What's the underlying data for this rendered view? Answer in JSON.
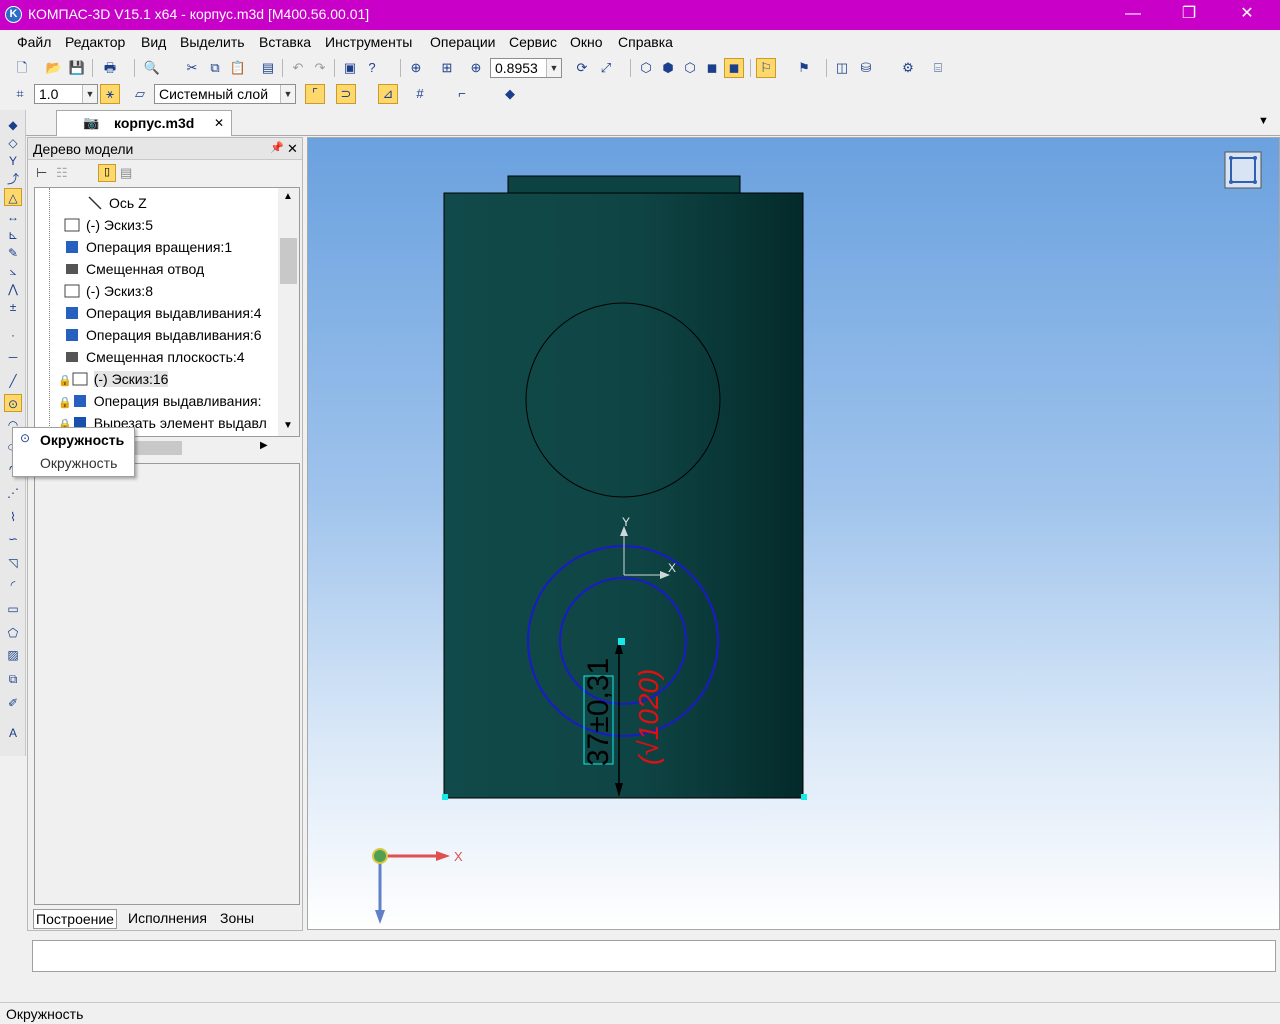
{
  "window": {
    "title": "КОМПАС-3D V15.1 x64 - корпус.m3d [M400.56.00.01]",
    "logo_text": "K",
    "minimize_glyph": "—",
    "maximize_glyph": "❐",
    "close_glyph": "✕"
  },
  "menu": [
    "Файл",
    "Редактор",
    "Вид",
    "Выделить",
    "Вставка",
    "Инструменты",
    "Операции",
    "Сервис",
    "Окно",
    "Справка"
  ],
  "toolbar": {
    "zoom_value": "0.8953",
    "step_value": "1.0",
    "layer_value": "Системный слой"
  },
  "document_tab": {
    "label": "корпус.m3d",
    "close_glyph": "✕"
  },
  "tabstrip_menu_glyph": "▼",
  "tree_panel": {
    "title": "Дерево модели",
    "pin_glyph": "📌",
    "close_glyph": "✕",
    "rows": [
      {
        "label": "Ось Z"
      },
      {
        "label": "(-) Эскиз:5"
      },
      {
        "label": "Операция вращения:1"
      },
      {
        "label": "Смещенная отвод"
      },
      {
        "label": "(-) Эскиз:8"
      },
      {
        "label": "Операция выдавливания:4"
      },
      {
        "label": "Операция выдавливания:6"
      },
      {
        "label": "Смещенная плоскость:4"
      },
      {
        "label": "(-) Эскиз:16"
      },
      {
        "label": "Операция выдавливания:"
      },
      {
        "label": "Вырезать элемент выдавл"
      }
    ],
    "bottom_tabs": [
      "Построение",
      "Исполнения",
      "Зоны"
    ]
  },
  "tooltip": {
    "title": "Окружность",
    "subtitle": "Окружность"
  },
  "sketch": {
    "dimension_text": "37±0,31",
    "roughness_text": "(√1020)",
    "axis_y": "Y",
    "axis_x": "X",
    "global_axis_x": "X"
  },
  "command_line": "",
  "status": {
    "text": "Окружность"
  },
  "colors": {
    "title_bar": "#c800c8",
    "model_body": "#0f4444",
    "sketch_lines": "#1a1acc",
    "dimension_red": "#e01010",
    "selection_cyan": "#18e8e8"
  }
}
